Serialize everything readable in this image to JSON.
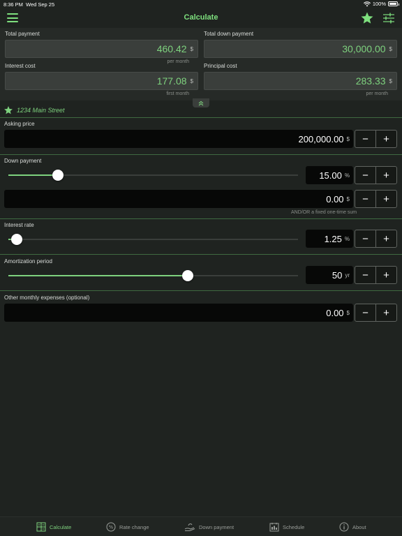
{
  "status_bar": {
    "time": "8:36 PM",
    "date": "Wed Sep 25",
    "battery": "100%"
  },
  "nav": {
    "title": "Calculate"
  },
  "summary": {
    "total_payment": {
      "label": "Total payment",
      "value": "460.42",
      "unit": "$",
      "sub": "per month"
    },
    "total_down_payment": {
      "label": "Total down payment",
      "value": "30,000.00",
      "unit": "$",
      "sub": ""
    },
    "interest_cost": {
      "label": "Interest cost",
      "value": "177.08",
      "unit": "$",
      "sub": "first month"
    },
    "principal_cost": {
      "label": "Principal cost",
      "value": "283.33",
      "unit": "$",
      "sub": "per month"
    }
  },
  "property": {
    "address": "1234 Main Street"
  },
  "asking_price": {
    "label": "Asking price",
    "value": "200,000.00",
    "unit": "$"
  },
  "down_payment": {
    "label": "Down payment",
    "percent_value": "15.00",
    "percent_unit": "%",
    "slider_fraction": 0.17,
    "fixed_value": "0.00",
    "fixed_unit": "$",
    "hint": "AND/OR a fixed one-time sum"
  },
  "interest_rate": {
    "label": "Interest rate",
    "value": "1.25",
    "unit": "%",
    "slider_fraction": 0.03
  },
  "amortization": {
    "label": "Amortization period",
    "value": "50",
    "unit": "yr",
    "slider_fraction": 0.62
  },
  "other_expenses": {
    "label": "Other monthly expenses (optional)",
    "value": "0.00",
    "unit": "$"
  },
  "stepper": {
    "minus": "−",
    "plus": "+"
  },
  "tabs": [
    {
      "label": "Calculate",
      "icon": "calculator-icon",
      "active": true
    },
    {
      "label": "Rate change",
      "icon": "percent-icon",
      "active": false
    },
    {
      "label": "Down payment",
      "icon": "hand-money-icon",
      "active": false
    },
    {
      "label": "Schedule",
      "icon": "schedule-icon",
      "active": false
    },
    {
      "label": "About",
      "icon": "info-icon",
      "active": false
    }
  ],
  "colors": {
    "accent": "#7ed27e",
    "background": "#1f2320",
    "field": "#3a3e3b",
    "input": "#070807"
  }
}
